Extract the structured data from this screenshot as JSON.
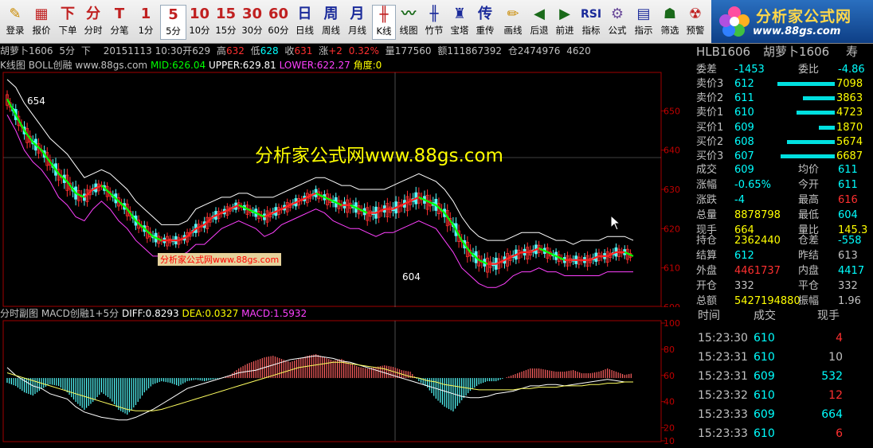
{
  "toolbar": [
    {
      "name": "login-button",
      "icon": "✎",
      "label": "登录",
      "color": "#c98a00"
    },
    {
      "name": "report-button",
      "icon": "▦",
      "label": "报价",
      "color": "#c02020"
    },
    {
      "name": "order-button",
      "icon": "下",
      "label": "下单",
      "color": "#c02020"
    },
    {
      "name": "tick-button",
      "icon": "分",
      "label": "分时",
      "color": "#c02020"
    },
    {
      "name": "trade-tick-button",
      "icon": "T",
      "label": "分笔",
      "color": "#c02020"
    },
    {
      "name": "period-1min-button",
      "icon": "1",
      "label": "1分",
      "color": "#c02020"
    },
    {
      "name": "period-5min-button",
      "icon": "5",
      "label": "5分",
      "color": "#c02020",
      "active": true
    },
    {
      "name": "period-10min-button",
      "icon": "10",
      "label": "10分",
      "color": "#c02020"
    },
    {
      "name": "period-15min-button",
      "icon": "15",
      "label": "15分",
      "color": "#c02020"
    },
    {
      "name": "period-30min-button",
      "icon": "30",
      "label": "30分",
      "color": "#c02020"
    },
    {
      "name": "period-60min-button",
      "icon": "60",
      "label": "60分",
      "color": "#c02020"
    },
    {
      "name": "period-day-button",
      "icon": "日",
      "label": "日线",
      "color": "#1a2a9a"
    },
    {
      "name": "period-week-button",
      "icon": "周",
      "label": "周线",
      "color": "#1a2a9a"
    },
    {
      "name": "period-month-button",
      "icon": "月",
      "label": "月线",
      "color": "#1a2a9a"
    },
    {
      "name": "kline-button",
      "icon": "╫",
      "label": "K线",
      "color": "#c02020",
      "active": true
    },
    {
      "name": "line-chart-button",
      "icon": "〰",
      "label": "线图",
      "color": "#1a6a1a"
    },
    {
      "name": "bamboo-button",
      "icon": "╫",
      "label": "竹节",
      "color": "#1a2a9a"
    },
    {
      "name": "pagoda-button",
      "icon": "♜",
      "label": "宝塔",
      "color": "#1a2a9a"
    },
    {
      "name": "redraw-button",
      "icon": "传",
      "label": "重传",
      "color": "#1a2a9a"
    },
    {
      "name": "draw-button",
      "icon": "✏",
      "label": "画线",
      "color": "#c98a00"
    },
    {
      "name": "back-button",
      "icon": "◀",
      "label": "后退",
      "color": "#1a6a1a"
    },
    {
      "name": "forward-button",
      "icon": "▶",
      "label": "前进",
      "color": "#1a6a1a"
    },
    {
      "name": "indicator-button",
      "icon": "RSI",
      "label": "指标",
      "color": "#1a2a9a"
    },
    {
      "name": "formula-button",
      "icon": "⚙",
      "label": "公式",
      "color": "#6a4a9a"
    },
    {
      "name": "signal-button",
      "icon": "▤",
      "label": "指示",
      "color": "#1a2a9a"
    },
    {
      "name": "filter-button",
      "icon": "☗",
      "label": "筛选",
      "color": "#1a6a1a"
    },
    {
      "name": "alert-button",
      "icon": "☢",
      "label": "预警",
      "color": "#c02020"
    }
  ],
  "logo": {
    "title": "分析家公式网",
    "url": "www.88gs.com"
  },
  "info": {
    "symbol": "胡萝卜1606",
    "period": "5分",
    "dir": "下",
    "datetime": "20151113 10:30",
    "open_label": "开",
    "open": "629",
    "high_label": "高",
    "high": "632",
    "low_label": "低",
    "low": "628",
    "close_label": "收",
    "close": "631",
    "change_label": "涨",
    "change": "+2",
    "pct": "0.32%",
    "vol_label": "量",
    "vol": "177560",
    "amt_label": "额",
    "amt": "111867392",
    "oi_label": "仓",
    "oi": "2474976",
    "oi_extra": "4620"
  },
  "kline_bar": {
    "title": "K线图",
    "indicator": "BOLL创融",
    "site": "www.88gs.com",
    "mid": "MID:626.04",
    "upper": "UPPER:629.81",
    "lower": "LOWER:622.27",
    "angle": "角度:0"
  },
  "macd_bar": {
    "title": "分时副图",
    "indicator": "MACD创融1+5分",
    "diff": "DIFF:0.8293",
    "dea": "DEA:0.0327",
    "macd": "MACD:1.5932"
  },
  "watermark": {
    "main": "分析家公式网www.88gs.com",
    "small": "分析家公式网www.88gs.com"
  },
  "annotations": {
    "high": "654",
    "low": "604"
  },
  "chart_data": [
    {
      "type": "candlestick",
      "name": "K线图",
      "ylim": [
        600,
        660
      ],
      "yticks": [
        "650",
        "640",
        "630",
        "620",
        "610",
        "600"
      ],
      "mid": [
        653,
        649,
        645,
        642,
        640,
        637,
        634,
        632,
        629,
        628,
        630,
        631,
        629,
        627,
        625,
        622,
        620,
        618,
        617,
        617,
        617,
        618,
        620,
        621,
        623,
        624,
        625,
        626,
        625,
        624,
        623,
        624,
        625,
        626,
        627,
        628,
        629,
        628,
        627,
        626,
        626,
        625,
        624,
        624,
        625,
        625,
        626,
        627,
        628,
        627,
        626,
        624,
        621,
        617,
        614,
        612,
        611,
        611,
        612,
        613,
        614,
        614,
        615,
        614,
        613,
        612,
        612,
        612,
        612,
        613,
        613,
        614,
        614,
        613
      ],
      "upper": [
        658,
        656,
        652,
        649,
        646,
        643,
        641,
        639,
        636,
        633,
        634,
        635,
        634,
        632,
        630,
        627,
        625,
        623,
        621,
        621,
        621,
        622,
        625,
        626,
        627,
        628,
        628,
        629,
        629,
        628,
        628,
        628,
        629,
        630,
        631,
        632,
        633,
        633,
        632,
        631,
        631,
        630,
        630,
        630,
        630,
        631,
        632,
        633,
        634,
        633,
        632,
        630,
        627,
        623,
        620,
        618,
        617,
        617,
        617,
        618,
        619,
        619,
        619,
        618,
        617,
        617,
        616,
        617,
        617,
        617,
        618,
        618,
        618,
        617
      ],
      "lower": [
        649,
        645,
        640,
        637,
        635,
        632,
        628,
        626,
        623,
        622,
        625,
        627,
        625,
        622,
        620,
        617,
        615,
        613,
        613,
        613,
        613,
        614,
        616,
        616,
        618,
        620,
        621,
        622,
        621,
        620,
        618,
        619,
        621,
        622,
        623,
        624,
        625,
        624,
        622,
        621,
        620,
        620,
        619,
        618,
        619,
        619,
        620,
        621,
        622,
        621,
        620,
        617,
        614,
        610,
        608,
        606,
        605,
        605,
        606,
        608,
        609,
        609,
        610,
        609,
        609,
        608,
        608,
        608,
        608,
        608,
        609,
        609,
        609,
        609
      ]
    },
    {
      "type": "bar",
      "name": "MACD创融1+5分",
      "ylim": [
        10,
        100
      ],
      "yticks": [
        "100",
        "80",
        "60",
        "40",
        "20",
        "10"
      ],
      "hist": [
        -6,
        -10,
        -18,
        -22,
        -14,
        -8,
        -10,
        -18,
        -30,
        -40,
        -30,
        -18,
        -26,
        -40,
        -46,
        -34,
        -18,
        -8,
        -4,
        -6,
        -10,
        -4,
        -2,
        -4,
        -2,
        0,
        4,
        12,
        18,
        22,
        26,
        28,
        24,
        20,
        24,
        28,
        30,
        26,
        22,
        24,
        18,
        14,
        12,
        14,
        16,
        14,
        10,
        8,
        -4,
        -12,
        -26,
        -36,
        -42,
        -28,
        -16,
        -8,
        -4,
        -4,
        0,
        4,
        8,
        12,
        12,
        10,
        8,
        8,
        10,
        6,
        6,
        8,
        12,
        8,
        4,
        6
      ],
      "diff": [
        66,
        60,
        56,
        52,
        50,
        46,
        44,
        42,
        36,
        32,
        30,
        28,
        27,
        26,
        26,
        28,
        31,
        34,
        38,
        42,
        46,
        50,
        52,
        54,
        56,
        58,
        60,
        62,
        63,
        64,
        66,
        68,
        70,
        72,
        73,
        74,
        75,
        74,
        73,
        71,
        70,
        68,
        66,
        64,
        62,
        60,
        58,
        56,
        54,
        52,
        50,
        48,
        46,
        44,
        43,
        43,
        44,
        46,
        47,
        48,
        50,
        52,
        52,
        53,
        53,
        52,
        53,
        54,
        55,
        56,
        57,
        56,
        55,
        55
      ],
      "dea": [
        62,
        60,
        58,
        56,
        54,
        52,
        50,
        48,
        46,
        44,
        42,
        40,
        38,
        36,
        34,
        33,
        33,
        33,
        34,
        36,
        38,
        40,
        42,
        44,
        46,
        48,
        50,
        52,
        54,
        56,
        58,
        60,
        62,
        64,
        66,
        67,
        68,
        69,
        70,
        70,
        69,
        68,
        67,
        66,
        65,
        63,
        61,
        59,
        58,
        56,
        55,
        53,
        52,
        51,
        50,
        49,
        49,
        49,
        49,
        49,
        50,
        50,
        51,
        51,
        51,
        52,
        52,
        52,
        53,
        53,
        54,
        54,
        55,
        55
      ]
    }
  ],
  "quote": {
    "code": "HLB1606",
    "name": "胡萝卜1606",
    "extra": "寿",
    "weicha_label": "委差",
    "weicha": "-1453",
    "weibi_label": "委比",
    "weibi": "-4.86",
    "asks": [
      {
        "label": "卖价3",
        "price": "612",
        "vol": "7098",
        "bar": 0.9
      },
      {
        "label": "卖价2",
        "price": "611",
        "vol": "3863",
        "bar": 0.5
      },
      {
        "label": "卖价1",
        "price": "610",
        "vol": "4723",
        "bar": 0.6
      }
    ],
    "bids": [
      {
        "label": "买价1",
        "price": "609",
        "vol": "1870",
        "bar": 0.25
      },
      {
        "label": "买价2",
        "price": "608",
        "vol": "5674",
        "bar": 0.75
      },
      {
        "label": "买价3",
        "price": "607",
        "vol": "6687",
        "bar": 0.85
      }
    ],
    "stats": [
      {
        "l1": "成交",
        "v1": "609",
        "c1": "#00ffff",
        "l2": "均价",
        "v2": "611",
        "c2": "#00ffff"
      },
      {
        "l1": "涨幅",
        "v1": "-0.65%",
        "c1": "#00ffff",
        "l2": "今开",
        "v2": "611",
        "c2": "#00ffff"
      },
      {
        "l1": "涨跌",
        "v1": "-4",
        "c1": "#00ffff",
        "l2": "最高",
        "v2": "616",
        "c2": "#ff3030"
      },
      {
        "l1": "总量",
        "v1": "8878798",
        "c1": "#ffff00",
        "l2": "最低",
        "v2": "604",
        "c2": "#00ffff"
      },
      {
        "l1": "现手",
        "v1": "664",
        "c1": "#ffff00",
        "l2": "量比",
        "v2": "145.3",
        "c2": "#ffff00"
      }
    ],
    "stats2": [
      {
        "l1": "持仓",
        "v1": "2362440",
        "c1": "#ffff00",
        "l2": "仓差",
        "v2": "-558",
        "c2": "#00ffff"
      },
      {
        "l1": "结算",
        "v1": "612",
        "c1": "#00ffff",
        "l2": "昨结",
        "v2": "613",
        "c2": "#c0c0c0"
      },
      {
        "l1": "外盘",
        "v1": "4461737",
        "c1": "#ff3030",
        "l2": "内盘",
        "v2": "4417",
        "c2": "#00ffff"
      },
      {
        "l1": "开仓",
        "v1": "332",
        "c1": "#c0c0c0",
        "l2": "平仓",
        "v2": "332",
        "c2": "#c0c0c0"
      },
      {
        "l1": "总额",
        "v1": "5427194880",
        "c1": "#ffff00",
        "l2": "振幅",
        "v2": "1.96",
        "c2": "#c0c0c0"
      }
    ],
    "ticks_header": {
      "time": "时间",
      "price": "成交",
      "vol": "现手"
    },
    "ticks": [
      {
        "time": "15:23:30",
        "price": "610",
        "vol": "4",
        "vc": "#ff3030"
      },
      {
        "time": "15:23:31",
        "price": "610",
        "vol": "10",
        "vc": "#c0c0c0"
      },
      {
        "time": "15:23:31",
        "price": "609",
        "vol": "532",
        "vc": "#00ffff"
      },
      {
        "time": "15:23:32",
        "price": "610",
        "vol": "12",
        "vc": "#ff3030"
      },
      {
        "time": "15:23:33",
        "price": "609",
        "vol": "664",
        "vc": "#00ffff"
      },
      {
        "time": "15:23:33",
        "price": "610",
        "vol": "6",
        "vc": "#ff3030"
      }
    ]
  }
}
